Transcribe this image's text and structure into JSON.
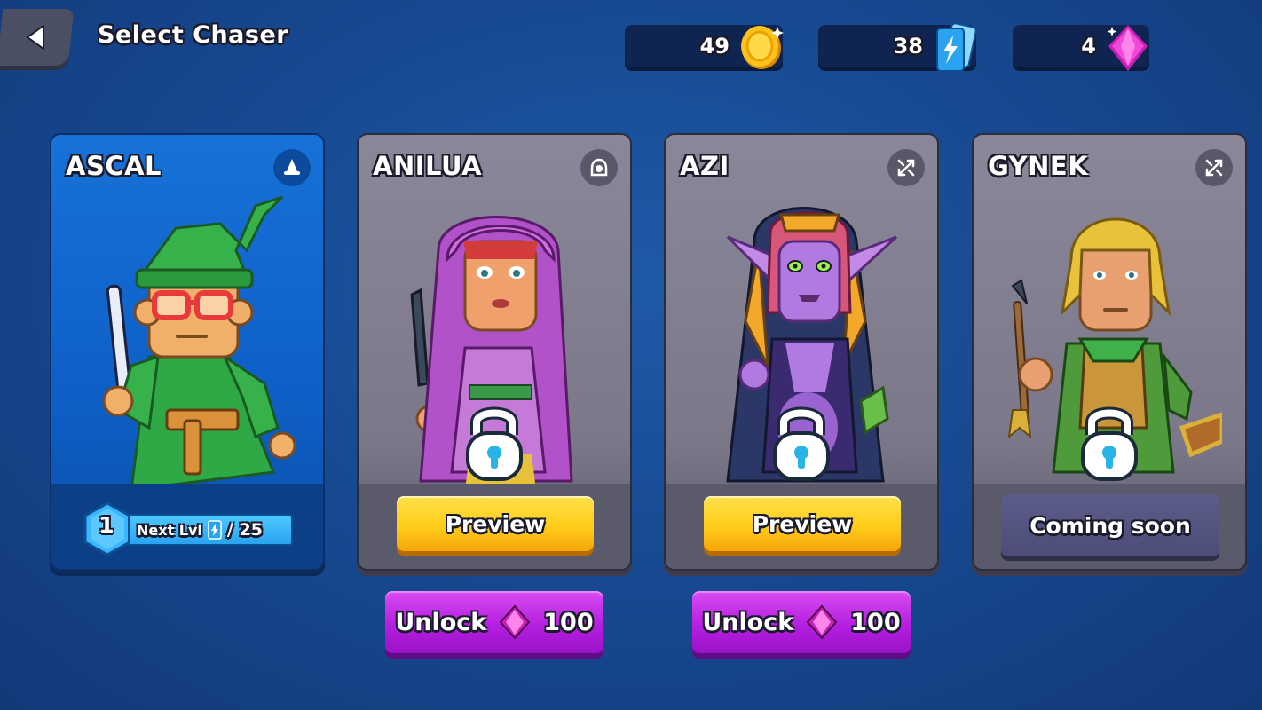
{
  "header": {
    "title": "Select Chaser",
    "back_icon": "back-arrow-icon"
  },
  "currencies": {
    "coins": {
      "value": "49",
      "icon": "gold-coin-icon",
      "color": "#f5b400"
    },
    "cards": {
      "value": "38",
      "icon": "energy-cards-icon",
      "color": "#39b6ff"
    },
    "gems": {
      "value": "4",
      "icon": "pink-gem-icon",
      "color": "#f03cd6"
    }
  },
  "chasers": [
    {
      "name": "ASCAL",
      "class_icon": "wizard-hat-icon",
      "state": "selected",
      "level": "1",
      "next_label": "Next Lvl",
      "next_cost": "/ 25",
      "colors": {
        "body": "#2fa846",
        "hat": "#37b24a",
        "glasses": "#e83a3a"
      }
    },
    {
      "name": "ANILUA",
      "class_icon": "hooded-figure-icon",
      "state": "locked",
      "preview_label": "Preview",
      "unlock_label": "Unlock",
      "unlock_cost": "100",
      "colors": {
        "hood": "#c960d8",
        "accent": "#d43b3b"
      }
    },
    {
      "name": "AZI",
      "class_icon": "crossed-weapon-icon",
      "state": "locked",
      "preview_label": "Preview",
      "unlock_label": "Unlock",
      "unlock_cost": "100",
      "colors": {
        "skin": "#b07ae0",
        "hood": "#2b3766",
        "gold": "#f2a92a"
      }
    },
    {
      "name": "GYNEK",
      "class_icon": "crossed-weapon-icon",
      "state": "coming_soon",
      "status_label": "Coming soon",
      "colors": {
        "hair": "#e8c23a",
        "tunic": "#4f9a3a"
      }
    }
  ]
}
